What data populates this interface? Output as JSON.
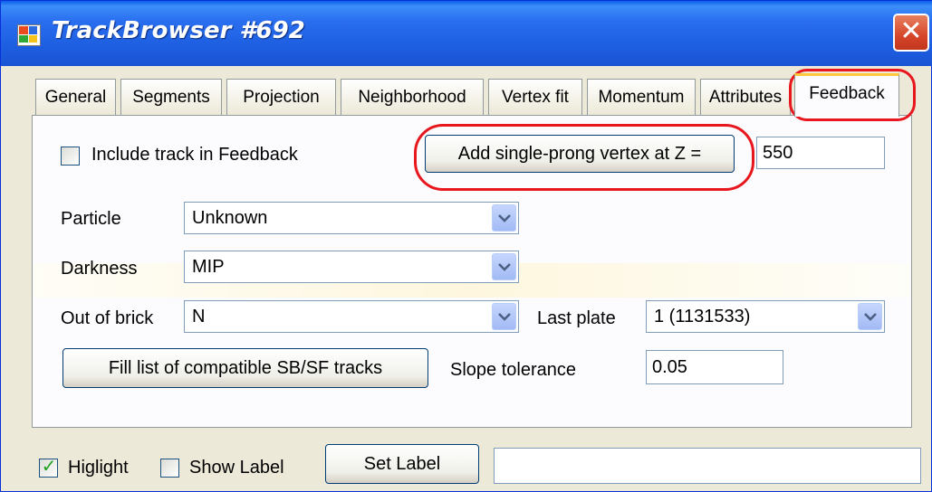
{
  "window": {
    "title": "TrackBrowser #692",
    "close_glyph": "✕"
  },
  "tabs": [
    {
      "label": "General"
    },
    {
      "label": "Segments"
    },
    {
      "label": "Projection"
    },
    {
      "label": "Neighborhood"
    },
    {
      "label": "Vertex fit"
    },
    {
      "label": "Momentum"
    },
    {
      "label": "Attributes"
    },
    {
      "label": "Feedback",
      "active": true
    }
  ],
  "feedback": {
    "include_label": "Include track in Feedback",
    "include_checked": false,
    "add_vertex_label": "Add single-prong vertex at Z =",
    "z_value": "550",
    "particle_label": "Particle",
    "particle_value": "Unknown",
    "darkness_label": "Darkness",
    "darkness_value": "MIP",
    "out_of_brick_label": "Out of brick",
    "out_of_brick_value": "N",
    "last_plate_label": "Last plate",
    "last_plate_value": "1 (1131533)",
    "fill_button_label": "Fill list of compatible SB/SF tracks",
    "slope_tolerance_label": "Slope tolerance",
    "slope_tolerance_value": "0.05"
  },
  "bottom": {
    "highlight_label": "Higlight",
    "highlight_checked": true,
    "show_label_label": "Show Label",
    "show_label_checked": false,
    "set_label_button": "Set Label",
    "label_value": ""
  },
  "icons": {
    "dropdown": "chevron-down-icon",
    "close": "close-icon",
    "app": "app-window-icon"
  },
  "colors": {
    "titlebar": "#1d5ee0",
    "annotation_red": "#e8161d",
    "active_tab_accent": "#ffc83c"
  }
}
